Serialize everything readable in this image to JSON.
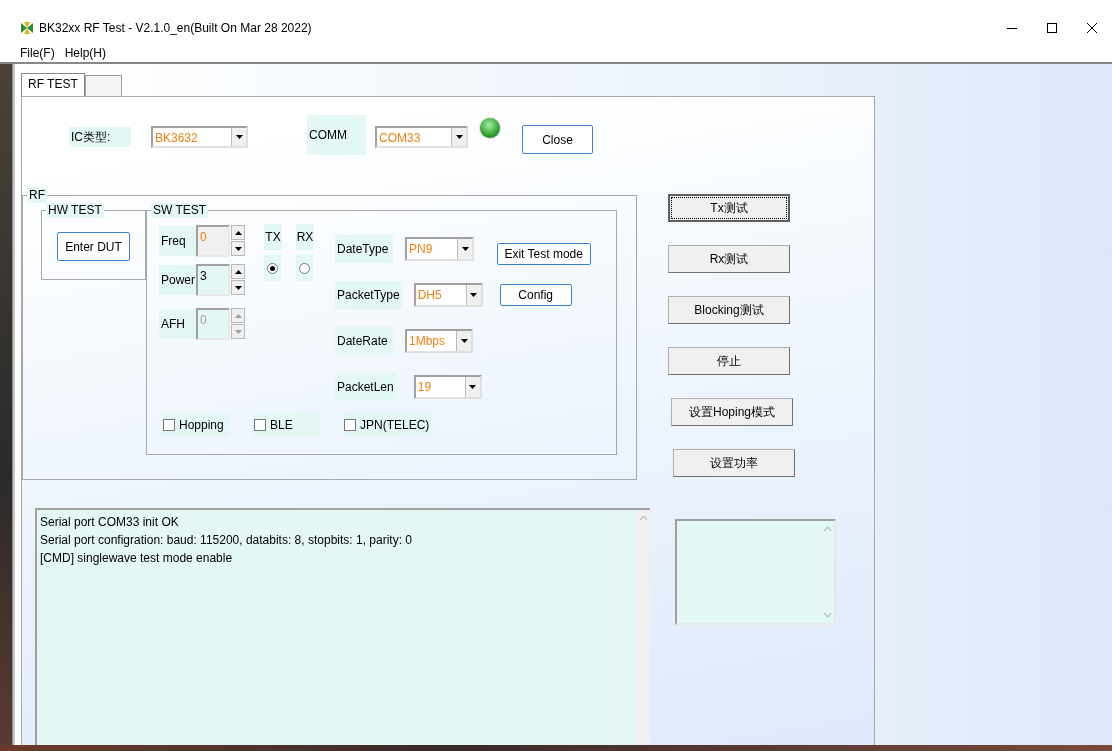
{
  "window": {
    "title": "BK32xx RF Test - V2.1.0_en(Built On Mar 28 2022)"
  },
  "menu": [
    {
      "label": "File(F)"
    },
    {
      "label": "Help(H)"
    }
  ],
  "tabs": [
    {
      "label": "RF TEST",
      "selected": true
    },
    {
      "selected": false
    }
  ],
  "connection": {
    "ic_label": "IC类型:",
    "ic_value": "BK3632",
    "comm_label": "COMM",
    "comm_value": "COM33",
    "connected": true,
    "close_button": "Close"
  },
  "rf_group": {
    "title": "RF",
    "hw_test": {
      "title": "HW TEST",
      "button": "Enter DUT"
    },
    "sw_test": {
      "title": "SW TEST",
      "spinners": [
        {
          "label": "Freq",
          "value": "0",
          "kind": "readonly"
        },
        {
          "label": "Power",
          "value": "3",
          "kind": "normal"
        },
        {
          "label": "AFH",
          "value": "0",
          "kind": "disabled"
        }
      ],
      "radios": [
        {
          "label": "TX",
          "selected": true
        },
        {
          "label": "RX",
          "selected": false
        }
      ],
      "combos": [
        {
          "label": "DateType",
          "value": "PN9"
        },
        {
          "label": "PacketType",
          "value": "DH5"
        },
        {
          "label": "DateRate",
          "value": "1Mbps"
        },
        {
          "label": "PacketLen",
          "value": "19"
        }
      ],
      "buttons": [
        "Exit Test mode",
        "Config"
      ],
      "checkboxes": [
        {
          "label": "Hopping",
          "checked": false
        },
        {
          "label": "BLE",
          "checked": false
        },
        {
          "label": "JPN(TELEC)",
          "checked": false
        }
      ]
    }
  },
  "test_buttons": [
    {
      "label": "Tx测试",
      "focused": true
    },
    {
      "label": "Rx测试",
      "focused": false
    },
    {
      "label": "Blocking测试",
      "focused": false
    },
    {
      "label": "停止",
      "focused": false
    },
    {
      "label": "设置Hoping模式",
      "focused": false
    },
    {
      "label": "设置功率",
      "focused": false
    }
  ],
  "log": {
    "lines": [
      "Serial port COM33 init OK",
      "Serial port configration: baud: 115200, databits: 8, stopbits: 1, parity: 0",
      "[CMD] singlewave test mode enable"
    ]
  }
}
